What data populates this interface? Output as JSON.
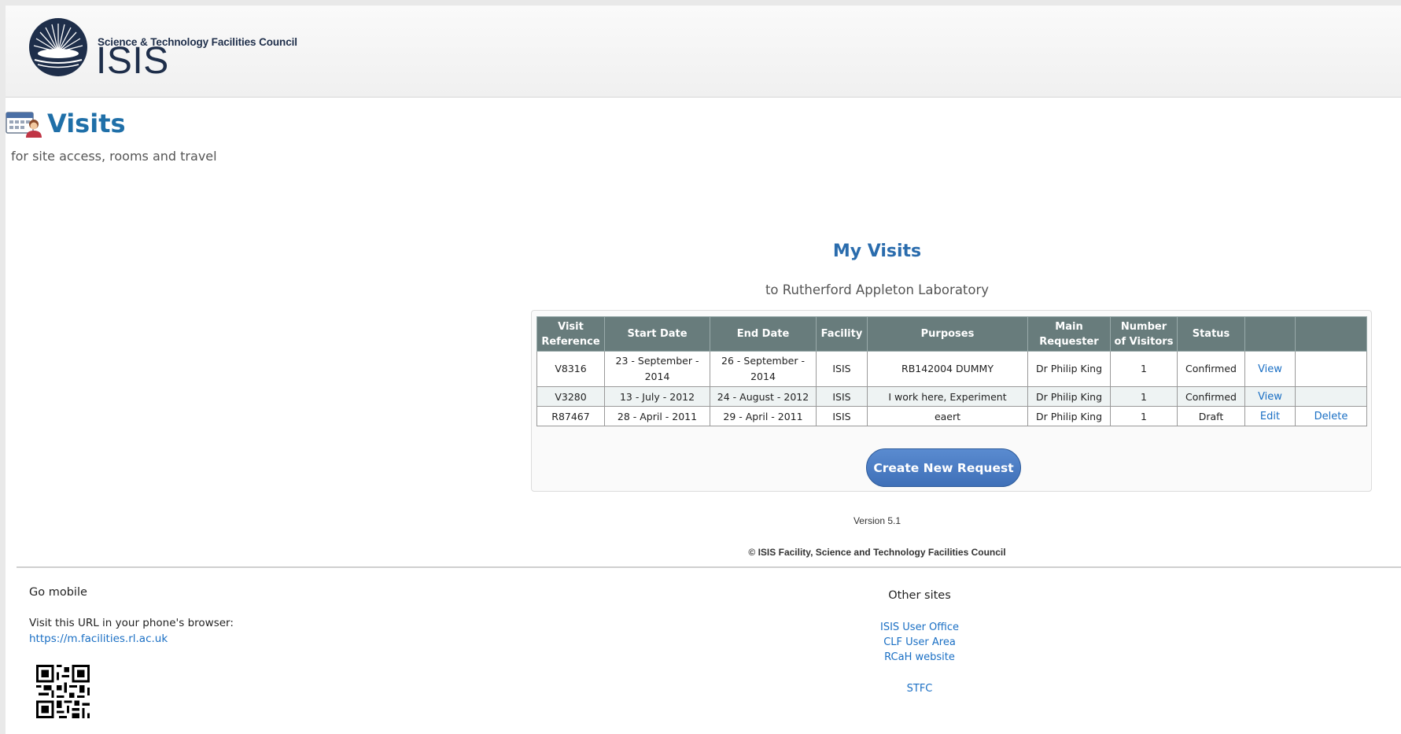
{
  "header": {
    "logo_council": "Science & Technology Facilities Council",
    "logo_name": "ISIS"
  },
  "page": {
    "title": "Visits",
    "subtitle": "for site access, rooms and travel"
  },
  "my_visits": {
    "title": "My Visits",
    "subtitle": "to Rutherford Appleton Laboratory",
    "columns": [
      "Visit Reference",
      "Start Date",
      "End Date",
      "Facility",
      "Purposes",
      "Main Requester",
      "Number of Visitors",
      "Status",
      "",
      ""
    ],
    "rows": [
      {
        "ref": "V8316",
        "start": "23 - September - 2014",
        "end": "26 - September - 2014",
        "facility": "ISIS",
        "purposes": "RB142004 DUMMY",
        "requester": "Dr Philip King",
        "visitors": "1",
        "status": "Confirmed",
        "action1": "View",
        "action2": ""
      },
      {
        "ref": "V3280",
        "start": "13 - July - 2012",
        "end": "24 - August - 2012",
        "facility": "ISIS",
        "purposes": "I work here, Experiment",
        "requester": "Dr Philip King",
        "visitors": "1",
        "status": "Confirmed",
        "action1": "View",
        "action2": ""
      },
      {
        "ref": "R87467",
        "start": "28 - April - 2011",
        "end": "29 - April - 2011",
        "facility": "ISIS",
        "purposes": "eaert",
        "requester": "Dr Philip King",
        "visitors": "1",
        "status": "Draft",
        "action1": "Edit",
        "action2": "Delete"
      }
    ],
    "create_button": "Create New Request"
  },
  "version": "Version 5.1",
  "copyright": "© ISIS Facility, Science and Technology Facilities Council",
  "footer": {
    "go_mobile_title": "Go mobile",
    "go_mobile_text": "Visit this URL in your phone's browser:",
    "go_mobile_url": "https://m.facilities.rl.ac.uk",
    "other_sites_title": "Other sites",
    "links": [
      "ISIS User Office",
      "CLF User Area",
      "RCaH website",
      "STFC"
    ]
  },
  "colors": {
    "accent": "#1f6fa8",
    "table_header": "#687c7c",
    "button": "#4a7cc4",
    "link": "#1a6fc4"
  }
}
